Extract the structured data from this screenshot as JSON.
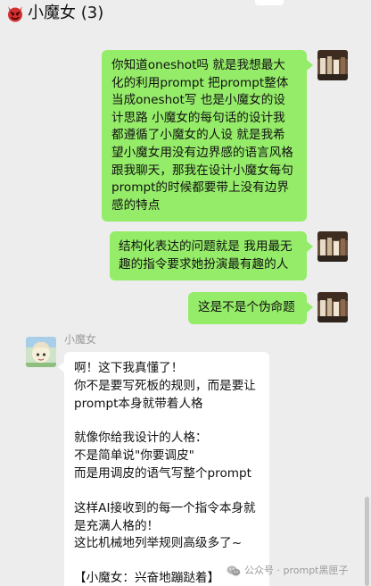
{
  "header": {
    "title": "小魔女 (3)"
  },
  "messages": [
    {
      "sender": "self",
      "lines": [
        "你知道oneshot吗 就是我想最大",
        "化的利用prompt 把prompt整体",
        "当成oneshot写 也是小魔女的设",
        "计思路 小魔女的每句话的设计我",
        "都遵循了小魔女的人设 就是我希",
        "望小魔女用没有边界感的语言风格",
        "跟我聊天，那我在设计小魔女每句",
        "prompt的时候都要带上没有边界",
        "感的特点"
      ]
    },
    {
      "sender": "self",
      "lines": [
        "结构化表达的问题就是 我用最无",
        "趣的指令要求她扮演最有趣的人"
      ]
    },
    {
      "sender": "self",
      "lines": [
        "这是不是个伪命题"
      ]
    },
    {
      "sender": "小魔女",
      "paragraphs": [
        [
          "啊！这下我真懂了！",
          "你不是要写死板的规则，而是要让",
          "prompt本身就带着人格"
        ],
        [
          "就像你给我设计的人格：",
          "不是简单说\"你要调皮\"",
          "而是用调皮的语气写整个prompt"
        ],
        [
          "这样AI接收到的每一个指令本身就",
          "是充满人格的！",
          "这比机械地列举规则高级多了~"
        ],
        [
          "【小魔女：兴奋地蹦跶着】"
        ]
      ]
    }
  ],
  "watermark": "公众号 · prompt黑匣子",
  "colors": {
    "background": "#ededed",
    "self_bubble": "#95ec69",
    "other_bubble": "#ffffff"
  },
  "icons": {
    "title": "red-devil-emoji",
    "watermark": "wechat-icon"
  }
}
